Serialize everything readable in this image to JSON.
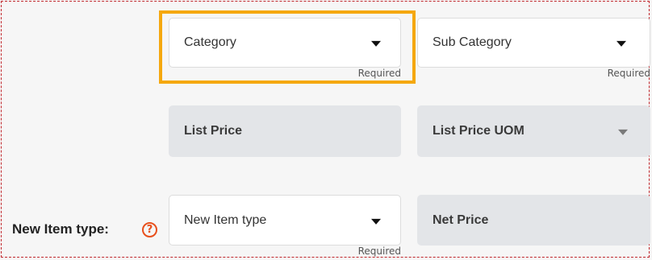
{
  "fields": {
    "category": {
      "placeholder": "Category",
      "note": "Required",
      "icon": "chevron-down-icon"
    },
    "sub_category": {
      "placeholder": "Sub Category",
      "note": "Required",
      "icon": "chevron-down-icon"
    },
    "list_price": {
      "placeholder": "List Price"
    },
    "list_price_uom": {
      "placeholder": "List Price UOM",
      "icon": "chevron-down-icon"
    },
    "new_item_type": {
      "placeholder": "New Item type",
      "note": "Required",
      "icon": "chevron-down-icon"
    },
    "net_price": {
      "placeholder": "Net Price"
    }
  },
  "labels": {
    "new_item_type": "New Item type:",
    "help_icon": "?"
  },
  "colors": {
    "highlight": "#f5a80f",
    "frame_border": "#c0282d",
    "help_icon": "#e8501c",
    "disabled_field": "#e3e5e8"
  }
}
